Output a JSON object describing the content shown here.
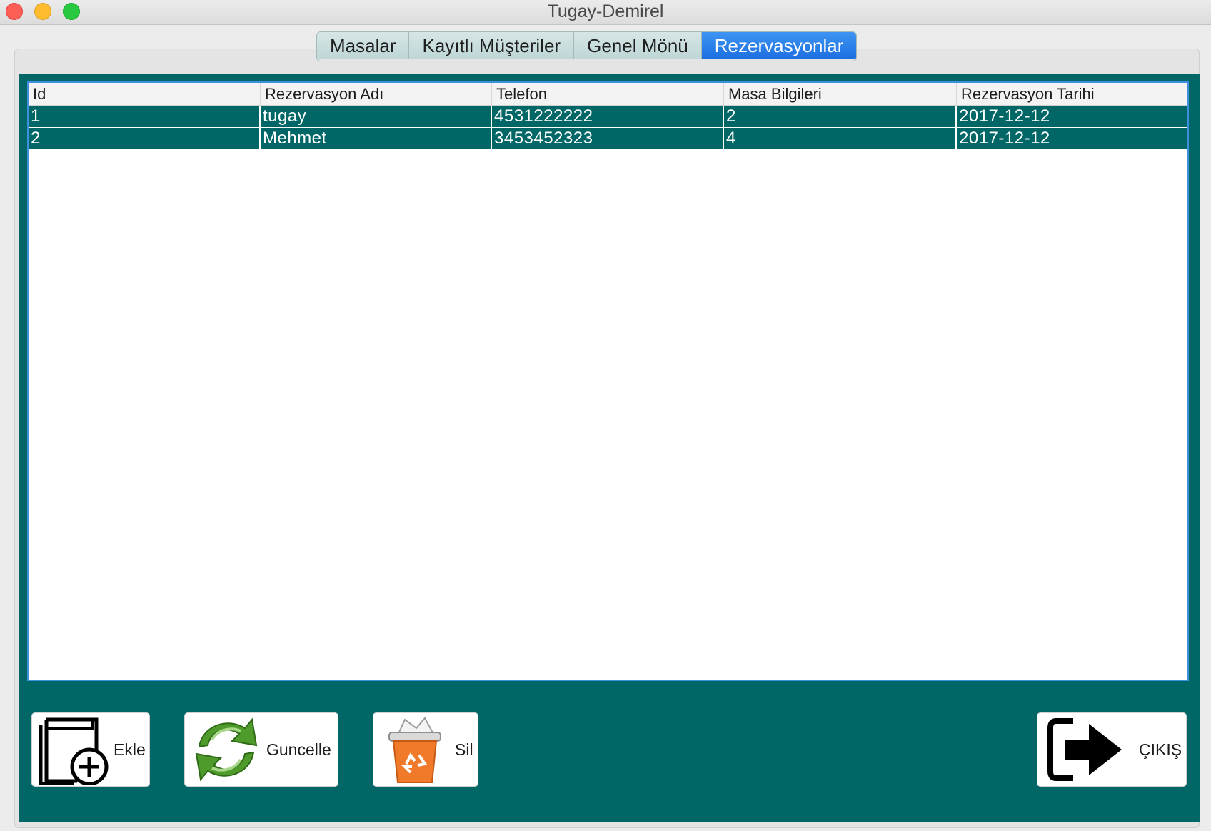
{
  "window": {
    "title": "Tugay-Demirel"
  },
  "tabs": [
    {
      "label": "Masalar",
      "active": false
    },
    {
      "label": "Kayıtlı Müşteriler",
      "active": false
    },
    {
      "label": "Genel Mönü",
      "active": false
    },
    {
      "label": "Rezervasyonlar",
      "active": true
    }
  ],
  "table": {
    "columns": [
      "Id",
      "Rezervasyon Adı",
      "Telefon",
      "Masa Bilgileri",
      "Rezervasyon Tarihi"
    ],
    "rows": [
      [
        "1",
        "tugay",
        "4531222222",
        "2",
        "2017-12-12"
      ],
      [
        "2",
        "Mehmet",
        "3453452323",
        "4",
        "2017-12-12"
      ]
    ]
  },
  "buttons": {
    "add_label": "Ekle",
    "update_label": "Guncelle",
    "delete_label": "Sil",
    "exit_label": "ÇIKIŞ"
  },
  "icons": {
    "add": "new-document-plus-icon",
    "update": "refresh-arrows-icon",
    "delete": "recycle-bin-icon",
    "exit": "exit-arrow-icon"
  },
  "colors": {
    "panel": "#006666",
    "selected_row": "#006666",
    "active_tab": "#1c6ee0",
    "inactive_tab": "#c8dede"
  }
}
